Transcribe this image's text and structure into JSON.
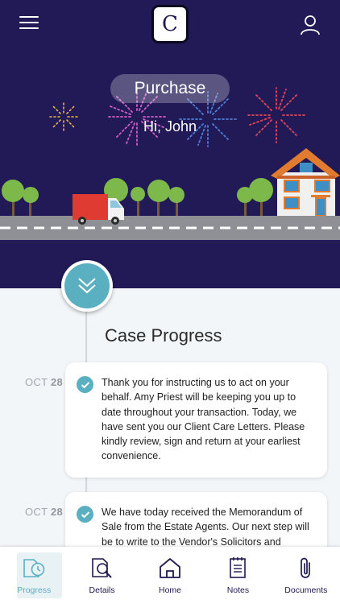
{
  "header": {
    "logo_letter": "C",
    "badge": "Purchase",
    "greeting": "Hi, John"
  },
  "main": {
    "title": "Case Progress",
    "entries": [
      {
        "month": "OCT",
        "day": "28",
        "text": "Thank you for instructing us to act on your behalf.  Amy Priest will be keeping you up to date throughout your transaction.  Today, we have sent you our Client Care Letters.  Please kindly review, sign and return at your earliest convenience."
      },
      {
        "month": "OCT",
        "day": "28",
        "text": "We have today received the Memorandum of Sale from the Estate Agents.  Our next step will be to write to the Vendor's Solicitors and"
      }
    ]
  },
  "nav": {
    "items": [
      {
        "label": "Progress",
        "icon": "progress-icon",
        "active": true
      },
      {
        "label": "Details",
        "icon": "details-icon",
        "active": false
      },
      {
        "label": "Home",
        "icon": "home-icon",
        "active": false
      },
      {
        "label": "Notes",
        "icon": "notes-icon",
        "active": false
      },
      {
        "label": "Documents",
        "icon": "paperclip-icon",
        "active": false
      }
    ]
  },
  "colors": {
    "header_bg": "#221a57",
    "accent": "#5aafc0",
    "nav_text": "#1f1a4f",
    "truck": "#e03b33",
    "road": "#8f8f96"
  }
}
